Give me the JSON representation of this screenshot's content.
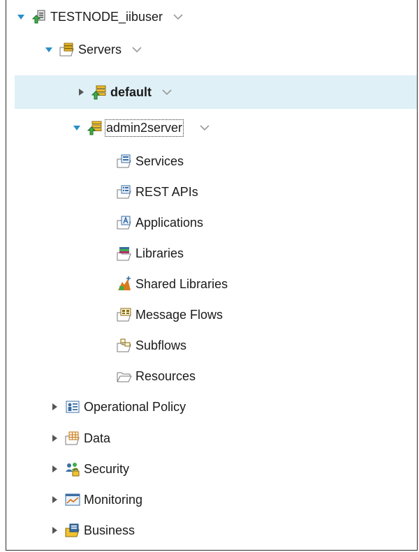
{
  "tree": {
    "node": {
      "label": "TESTNODE_iibuser",
      "expanded": true
    },
    "servers": {
      "label": "Servers",
      "expanded": true
    },
    "default_server": {
      "label": "default",
      "expanded": false,
      "selected": true
    },
    "admin_server": {
      "label": "admin2server",
      "expanded": true,
      "focused": true
    },
    "children": [
      {
        "label": "Services",
        "icon": "services-icon"
      },
      {
        "label": "REST APIs",
        "icon": "rest-apis-icon"
      },
      {
        "label": "Applications",
        "icon": "applications-icon"
      },
      {
        "label": "Libraries",
        "icon": "libraries-icon"
      },
      {
        "label": "Shared Libraries",
        "icon": "shared-libraries-icon"
      },
      {
        "label": "Message Flows",
        "icon": "message-flows-icon"
      },
      {
        "label": "Subflows",
        "icon": "subflows-icon"
      },
      {
        "label": "Resources",
        "icon": "resources-folder-icon"
      }
    ],
    "sections": [
      {
        "label": "Operational Policy",
        "icon": "operational-policy-icon"
      },
      {
        "label": "Data",
        "icon": "data-icon"
      },
      {
        "label": "Security",
        "icon": "security-icon"
      },
      {
        "label": "Monitoring",
        "icon": "monitoring-icon"
      },
      {
        "label": "Business",
        "icon": "business-icon"
      }
    ]
  },
  "colors": {
    "accent": "#2a8fc7",
    "selection": "#dff0f7",
    "folder": "#7a7a7a"
  }
}
